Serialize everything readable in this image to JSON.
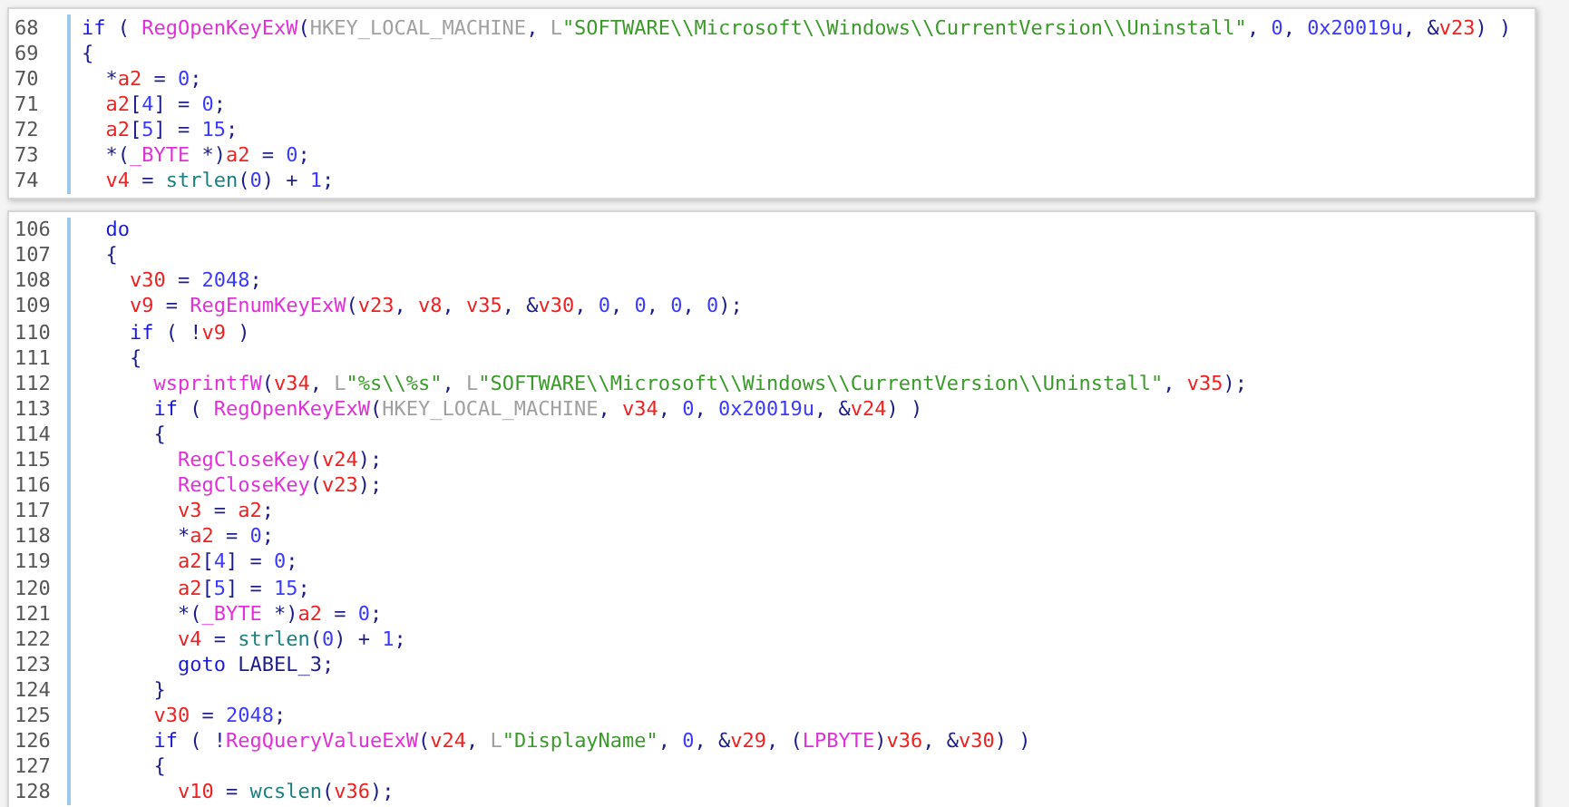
{
  "panels": [
    {
      "lines": [
        {
          "number": "68",
          "tokens": [
            {
              "kind": "kw",
              "text": "if"
            },
            {
              "kind": "p",
              "text": " ( "
            },
            {
              "kind": "fn",
              "text": "RegOpenKeyExW"
            },
            {
              "kind": "p",
              "text": "("
            },
            {
              "kind": "c",
              "text": "HKEY_LOCAL_MACHINE"
            },
            {
              "kind": "p",
              "text": ", "
            },
            {
              "kind": "c",
              "text": "L"
            },
            {
              "kind": "s",
              "text": "\"SOFTWARE\\\\Microsoft\\\\Windows\\\\CurrentVersion\\\\Uninstall\""
            },
            {
              "kind": "p",
              "text": ", "
            },
            {
              "kind": "n",
              "text": "0"
            },
            {
              "kind": "p",
              "text": ", "
            },
            {
              "kind": "n",
              "text": "0x20019u"
            },
            {
              "kind": "p",
              "text": ", &"
            },
            {
              "kind": "v",
              "text": "v23"
            },
            {
              "kind": "p",
              "text": ") )"
            }
          ]
        },
        {
          "number": "69",
          "tokens": [
            {
              "kind": "p",
              "text": "{"
            }
          ]
        },
        {
          "number": "70",
          "tokens": [
            {
              "kind": "p",
              "text": "  *"
            },
            {
              "kind": "v",
              "text": "a2"
            },
            {
              "kind": "p",
              "text": " = "
            },
            {
              "kind": "n",
              "text": "0"
            },
            {
              "kind": "p",
              "text": ";"
            }
          ]
        },
        {
          "number": "71",
          "tokens": [
            {
              "kind": "v",
              "text": "  a2"
            },
            {
              "kind": "p",
              "text": "["
            },
            {
              "kind": "n",
              "text": "4"
            },
            {
              "kind": "p",
              "text": "] = "
            },
            {
              "kind": "n",
              "text": "0"
            },
            {
              "kind": "p",
              "text": ";"
            }
          ]
        },
        {
          "number": "72",
          "tokens": [
            {
              "kind": "v",
              "text": "  a2"
            },
            {
              "kind": "p",
              "text": "["
            },
            {
              "kind": "n",
              "text": "5"
            },
            {
              "kind": "p",
              "text": "] = "
            },
            {
              "kind": "n",
              "text": "15"
            },
            {
              "kind": "p",
              "text": ";"
            }
          ]
        },
        {
          "number": "73",
          "tokens": [
            {
              "kind": "p",
              "text": "  *("
            },
            {
              "kind": "fn",
              "text": "_BYTE"
            },
            {
              "kind": "p",
              "text": " *)"
            },
            {
              "kind": "v",
              "text": "a2"
            },
            {
              "kind": "p",
              "text": " = "
            },
            {
              "kind": "n",
              "text": "0"
            },
            {
              "kind": "p",
              "text": ";"
            }
          ]
        },
        {
          "number": "74",
          "tokens": [
            {
              "kind": "v",
              "text": "  v4"
            },
            {
              "kind": "p",
              "text": " = "
            },
            {
              "kind": "lib",
              "text": "strlen"
            },
            {
              "kind": "p",
              "text": "("
            },
            {
              "kind": "n",
              "text": "0"
            },
            {
              "kind": "p",
              "text": ") + "
            },
            {
              "kind": "n",
              "text": "1"
            },
            {
              "kind": "p",
              "text": ";"
            }
          ]
        }
      ]
    },
    {
      "lines": [
        {
          "number": "106",
          "tokens": [
            {
              "kind": "kw",
              "text": "  do"
            }
          ]
        },
        {
          "number": "107",
          "tokens": [
            {
              "kind": "p",
              "text": "  {"
            }
          ]
        },
        {
          "number": "108",
          "tokens": [
            {
              "kind": "v",
              "text": "    v30"
            },
            {
              "kind": "p",
              "text": " = "
            },
            {
              "kind": "n",
              "text": "2048"
            },
            {
              "kind": "p",
              "text": ";"
            }
          ]
        },
        {
          "number": "109",
          "tokens": [
            {
              "kind": "v",
              "text": "    v9"
            },
            {
              "kind": "p",
              "text": " = "
            },
            {
              "kind": "fn",
              "text": "RegEnumKeyExW"
            },
            {
              "kind": "p",
              "text": "("
            },
            {
              "kind": "v",
              "text": "v23"
            },
            {
              "kind": "p",
              "text": ", "
            },
            {
              "kind": "v",
              "text": "v8"
            },
            {
              "kind": "p",
              "text": ", "
            },
            {
              "kind": "v",
              "text": "v35"
            },
            {
              "kind": "p",
              "text": ", &"
            },
            {
              "kind": "v",
              "text": "v30"
            },
            {
              "kind": "p",
              "text": ", "
            },
            {
              "kind": "n",
              "text": "0"
            },
            {
              "kind": "p",
              "text": ", "
            },
            {
              "kind": "n",
              "text": "0"
            },
            {
              "kind": "p",
              "text": ", "
            },
            {
              "kind": "n",
              "text": "0"
            },
            {
              "kind": "p",
              "text": ", "
            },
            {
              "kind": "n",
              "text": "0"
            },
            {
              "kind": "p",
              "text": ");"
            }
          ]
        },
        {
          "number": "110",
          "tokens": [
            {
              "kind": "kw",
              "text": "    if"
            },
            {
              "kind": "p",
              "text": " ( !"
            },
            {
              "kind": "v",
              "text": "v9"
            },
            {
              "kind": "p",
              "text": " )"
            }
          ]
        },
        {
          "number": "111",
          "tokens": [
            {
              "kind": "p",
              "text": "    {"
            }
          ]
        },
        {
          "number": "112",
          "tokens": [
            {
              "kind": "fn",
              "text": "      wsprintfW"
            },
            {
              "kind": "p",
              "text": "("
            },
            {
              "kind": "v",
              "text": "v34"
            },
            {
              "kind": "p",
              "text": ", "
            },
            {
              "kind": "c",
              "text": "L"
            },
            {
              "kind": "s",
              "text": "\"%s\\\\%s\""
            },
            {
              "kind": "p",
              "text": ", "
            },
            {
              "kind": "c",
              "text": "L"
            },
            {
              "kind": "s",
              "text": "\"SOFTWARE\\\\Microsoft\\\\Windows\\\\CurrentVersion\\\\Uninstall\""
            },
            {
              "kind": "p",
              "text": ", "
            },
            {
              "kind": "v",
              "text": "v35"
            },
            {
              "kind": "p",
              "text": ");"
            }
          ]
        },
        {
          "number": "113",
          "tokens": [
            {
              "kind": "kw",
              "text": "      if"
            },
            {
              "kind": "p",
              "text": " ( "
            },
            {
              "kind": "fn",
              "text": "RegOpenKeyExW"
            },
            {
              "kind": "p",
              "text": "("
            },
            {
              "kind": "c",
              "text": "HKEY_LOCAL_MACHINE"
            },
            {
              "kind": "p",
              "text": ", "
            },
            {
              "kind": "v",
              "text": "v34"
            },
            {
              "kind": "p",
              "text": ", "
            },
            {
              "kind": "n",
              "text": "0"
            },
            {
              "kind": "p",
              "text": ", "
            },
            {
              "kind": "n",
              "text": "0x20019u"
            },
            {
              "kind": "p",
              "text": ", &"
            },
            {
              "kind": "v",
              "text": "v24"
            },
            {
              "kind": "p",
              "text": ") )"
            }
          ]
        },
        {
          "number": "114",
          "tokens": [
            {
              "kind": "p",
              "text": "      {"
            }
          ]
        },
        {
          "number": "115",
          "tokens": [
            {
              "kind": "fn",
              "text": "        RegCloseKey"
            },
            {
              "kind": "p",
              "text": "("
            },
            {
              "kind": "v",
              "text": "v24"
            },
            {
              "kind": "p",
              "text": ");"
            }
          ]
        },
        {
          "number": "116",
          "tokens": [
            {
              "kind": "fn",
              "text": "        RegCloseKey"
            },
            {
              "kind": "p",
              "text": "("
            },
            {
              "kind": "v",
              "text": "v23"
            },
            {
              "kind": "p",
              "text": ");"
            }
          ]
        },
        {
          "number": "117",
          "tokens": [
            {
              "kind": "v",
              "text": "        v3"
            },
            {
              "kind": "p",
              "text": " = "
            },
            {
              "kind": "v",
              "text": "a2"
            },
            {
              "kind": "p",
              "text": ";"
            }
          ]
        },
        {
          "number": "118",
          "tokens": [
            {
              "kind": "p",
              "text": "        *"
            },
            {
              "kind": "v",
              "text": "a2"
            },
            {
              "kind": "p",
              "text": " = "
            },
            {
              "kind": "n",
              "text": "0"
            },
            {
              "kind": "p",
              "text": ";"
            }
          ]
        },
        {
          "number": "119",
          "tokens": [
            {
              "kind": "v",
              "text": "        a2"
            },
            {
              "kind": "p",
              "text": "["
            },
            {
              "kind": "n",
              "text": "4"
            },
            {
              "kind": "p",
              "text": "] = "
            },
            {
              "kind": "n",
              "text": "0"
            },
            {
              "kind": "p",
              "text": ";"
            }
          ]
        },
        {
          "number": "120",
          "tokens": [
            {
              "kind": "v",
              "text": "        a2"
            },
            {
              "kind": "p",
              "text": "["
            },
            {
              "kind": "n",
              "text": "5"
            },
            {
              "kind": "p",
              "text": "] = "
            },
            {
              "kind": "n",
              "text": "15"
            },
            {
              "kind": "p",
              "text": ";"
            }
          ]
        },
        {
          "number": "121",
          "tokens": [
            {
              "kind": "p",
              "text": "        *("
            },
            {
              "kind": "fn",
              "text": "_BYTE"
            },
            {
              "kind": "p",
              "text": " *)"
            },
            {
              "kind": "v",
              "text": "a2"
            },
            {
              "kind": "p",
              "text": " = "
            },
            {
              "kind": "n",
              "text": "0"
            },
            {
              "kind": "p",
              "text": ";"
            }
          ]
        },
        {
          "number": "122",
          "tokens": [
            {
              "kind": "v",
              "text": "        v4"
            },
            {
              "kind": "p",
              "text": " = "
            },
            {
              "kind": "lib",
              "text": "strlen"
            },
            {
              "kind": "p",
              "text": "("
            },
            {
              "kind": "n",
              "text": "0"
            },
            {
              "kind": "p",
              "text": ") + "
            },
            {
              "kind": "n",
              "text": "1"
            },
            {
              "kind": "p",
              "text": ";"
            }
          ]
        },
        {
          "number": "123",
          "tokens": [
            {
              "kind": "kw",
              "text": "        goto"
            },
            {
              "kind": "p",
              "text": " LABEL_3;"
            }
          ]
        },
        {
          "number": "124",
          "tokens": [
            {
              "kind": "p",
              "text": "      }"
            }
          ]
        },
        {
          "number": "125",
          "tokens": [
            {
              "kind": "v",
              "text": "      v30"
            },
            {
              "kind": "p",
              "text": " = "
            },
            {
              "kind": "n",
              "text": "2048"
            },
            {
              "kind": "p",
              "text": ";"
            }
          ]
        },
        {
          "number": "126",
          "tokens": [
            {
              "kind": "kw",
              "text": "      if"
            },
            {
              "kind": "p",
              "text": " ( !"
            },
            {
              "kind": "fn",
              "text": "RegQueryValueExW"
            },
            {
              "kind": "p",
              "text": "("
            },
            {
              "kind": "v",
              "text": "v24"
            },
            {
              "kind": "p",
              "text": ", "
            },
            {
              "kind": "c",
              "text": "L"
            },
            {
              "kind": "s",
              "text": "\"DisplayName\""
            },
            {
              "kind": "p",
              "text": ", "
            },
            {
              "kind": "n",
              "text": "0"
            },
            {
              "kind": "p",
              "text": ", &"
            },
            {
              "kind": "v",
              "text": "v29"
            },
            {
              "kind": "p",
              "text": ", ("
            },
            {
              "kind": "fn",
              "text": "LPBYTE"
            },
            {
              "kind": "p",
              "text": ")"
            },
            {
              "kind": "v",
              "text": "v36"
            },
            {
              "kind": "p",
              "text": ", &"
            },
            {
              "kind": "v",
              "text": "v30"
            },
            {
              "kind": "p",
              "text": ") )"
            }
          ]
        },
        {
          "number": "127",
          "tokens": [
            {
              "kind": "p",
              "text": "      {"
            }
          ]
        },
        {
          "number": "128",
          "tokens": [
            {
              "kind": "v",
              "text": "        v10"
            },
            {
              "kind": "p",
              "text": " = "
            },
            {
              "kind": "lib",
              "text": "wcslen"
            },
            {
              "kind": "p",
              "text": "("
            },
            {
              "kind": "v",
              "text": "v36"
            },
            {
              "kind": "p",
              "text": ");"
            }
          ]
        }
      ]
    }
  ]
}
